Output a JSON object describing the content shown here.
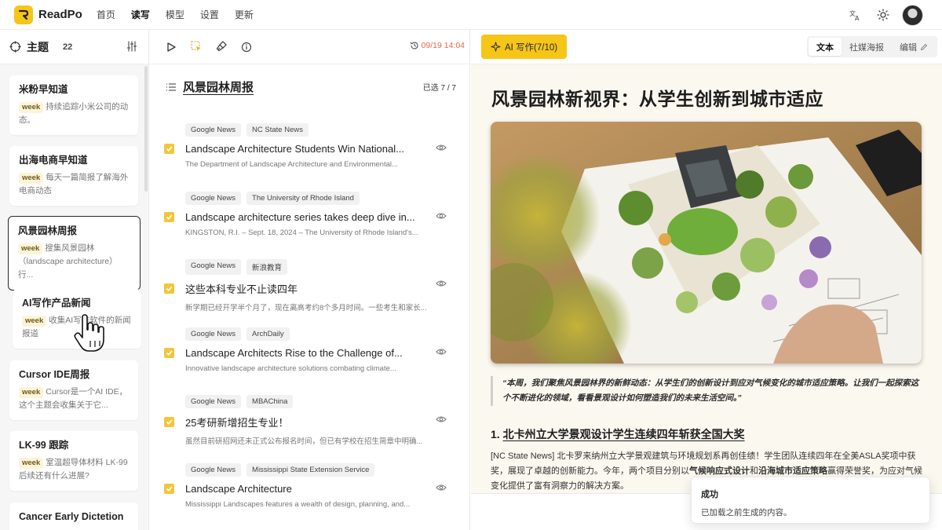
{
  "app": {
    "name": "ReadPo"
  },
  "nav": {
    "items": [
      "首页",
      "读写",
      "模型",
      "设置",
      "更新"
    ],
    "active_index": 1
  },
  "sidebar": {
    "title": "主题",
    "count": "22",
    "topics": [
      {
        "name": "米粉早知道",
        "tag": "week",
        "desc": "持续追踪小米公司的动态。"
      },
      {
        "name": "出海电商早知道",
        "tag": "week",
        "desc": "每天一篇简报了解海外电商动态"
      },
      {
        "name": "风景园林周报",
        "tag": "week",
        "desc": "搜集风景园林（landscape architecture）行...",
        "selected": true
      },
      {
        "name": "AI写作产品新闻",
        "tag": "week",
        "desc": "收集AI写作软件的新闻报道"
      },
      {
        "name": "Cursor IDE周报",
        "tag": "week",
        "desc": "Cursor是一个AI IDE，这个主题会收集关于它..."
      },
      {
        "name": "LK-99 跟踪",
        "tag": "week",
        "desc": "室温超导体材料 LK-99 后续还有什么进展?"
      },
      {
        "name": "Cancer Early Dictetion",
        "tag": "",
        "desc": ""
      }
    ]
  },
  "toolbar": {
    "timestamp": "09/19 14:04"
  },
  "article_list": {
    "title": "风景园林周报",
    "selected_label": "已选 7 / 7",
    "articles": [
      {
        "sources": [
          "Google News",
          "NC State News"
        ],
        "title": "Landscape Architecture Students Win National...",
        "snippet": "The Department of Landscape Architecture and Environmental..."
      },
      {
        "sources": [
          "Google News",
          "The University of Rhode Island"
        ],
        "title": "Landscape architecture series takes deep dive in...",
        "snippet": "KINGSTON, R.I. – Sept. 18, 2024 – The University of Rhode Island's..."
      },
      {
        "sources": [
          "Google News",
          "新浪教育"
        ],
        "title": "这些本科专业不止读四年",
        "snippet": "新学期已经开学半个月了，现在离高考约8个多月时间。一些考生和家长..."
      },
      {
        "sources": [
          "Google News",
          "ArchDaily"
        ],
        "title": "Landscape Architects Rise to the Challenge of...",
        "snippet": "Innovative landscape architecture solutions combating climate..."
      },
      {
        "sources": [
          "Google News",
          "MBAChina"
        ],
        "title": "25考研新增招生专业！",
        "snippet": "虽然目前研招网还未正式公布报名时间，但已有学校在招生简章中明确..."
      },
      {
        "sources": [
          "Google News",
          "Mississippi State Extension Service"
        ],
        "title": "Landscape Architecture",
        "snippet": "Mississippi Landscapes features a wealth of design, planning, and..."
      }
    ]
  },
  "preview": {
    "ai_button": "AI 写作(7/10)",
    "tabs": [
      "文本",
      "社媒海报",
      "编辑"
    ],
    "active_tab": 0,
    "title": "风景园林新视界：从学生创新到城市适应",
    "quote": "“本周，我们聚焦风景园林界的新鲜动态：从学生们的创新设计到应对气候变化的城市适应策略。让我们一起探索这个不断进化的领域，看看景观设计如何塑造我们的未来生活空间。”",
    "section_number": "1.",
    "section_title": "北卡州立大学景观设计学生连续四年斩获全国大奖",
    "section_body_a": "[NC State News] 北卡罗来纳州立大学景观建筑与环境规划系再创佳绩！学生团队连续四年在全美ASLA奖项中获奖，展现了卓越的创新能力。今年，两个项目分别以",
    "section_bold_1": "气候响应式设计",
    "section_body_b": "和",
    "section_bold_2": "沿海城市适应策略",
    "section_body_c": "赢得荣誉奖，为应对气候变化提供了富有洞察力的解决方案。"
  },
  "toast": {
    "title": "成功",
    "message": "已加载之前生成的内容。"
  },
  "colors": {
    "accent": "#f5c518",
    "timestamp": "#e36a4a"
  }
}
